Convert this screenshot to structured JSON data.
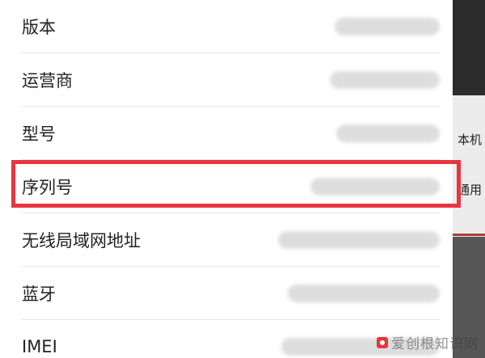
{
  "backdrop": {
    "text_1": "本机",
    "text_2": "通用"
  },
  "rows": [
    {
      "label": "版本"
    },
    {
      "label": "运营商"
    },
    {
      "label": "型号"
    },
    {
      "label": "序列号"
    },
    {
      "label": "无线局域网地址"
    },
    {
      "label": "蓝牙"
    },
    {
      "label": "IMEI"
    }
  ],
  "watermark": {
    "text": "爱创根知识网"
  },
  "colors": {
    "highlight": "#e8353f",
    "background": "#ffffff"
  }
}
